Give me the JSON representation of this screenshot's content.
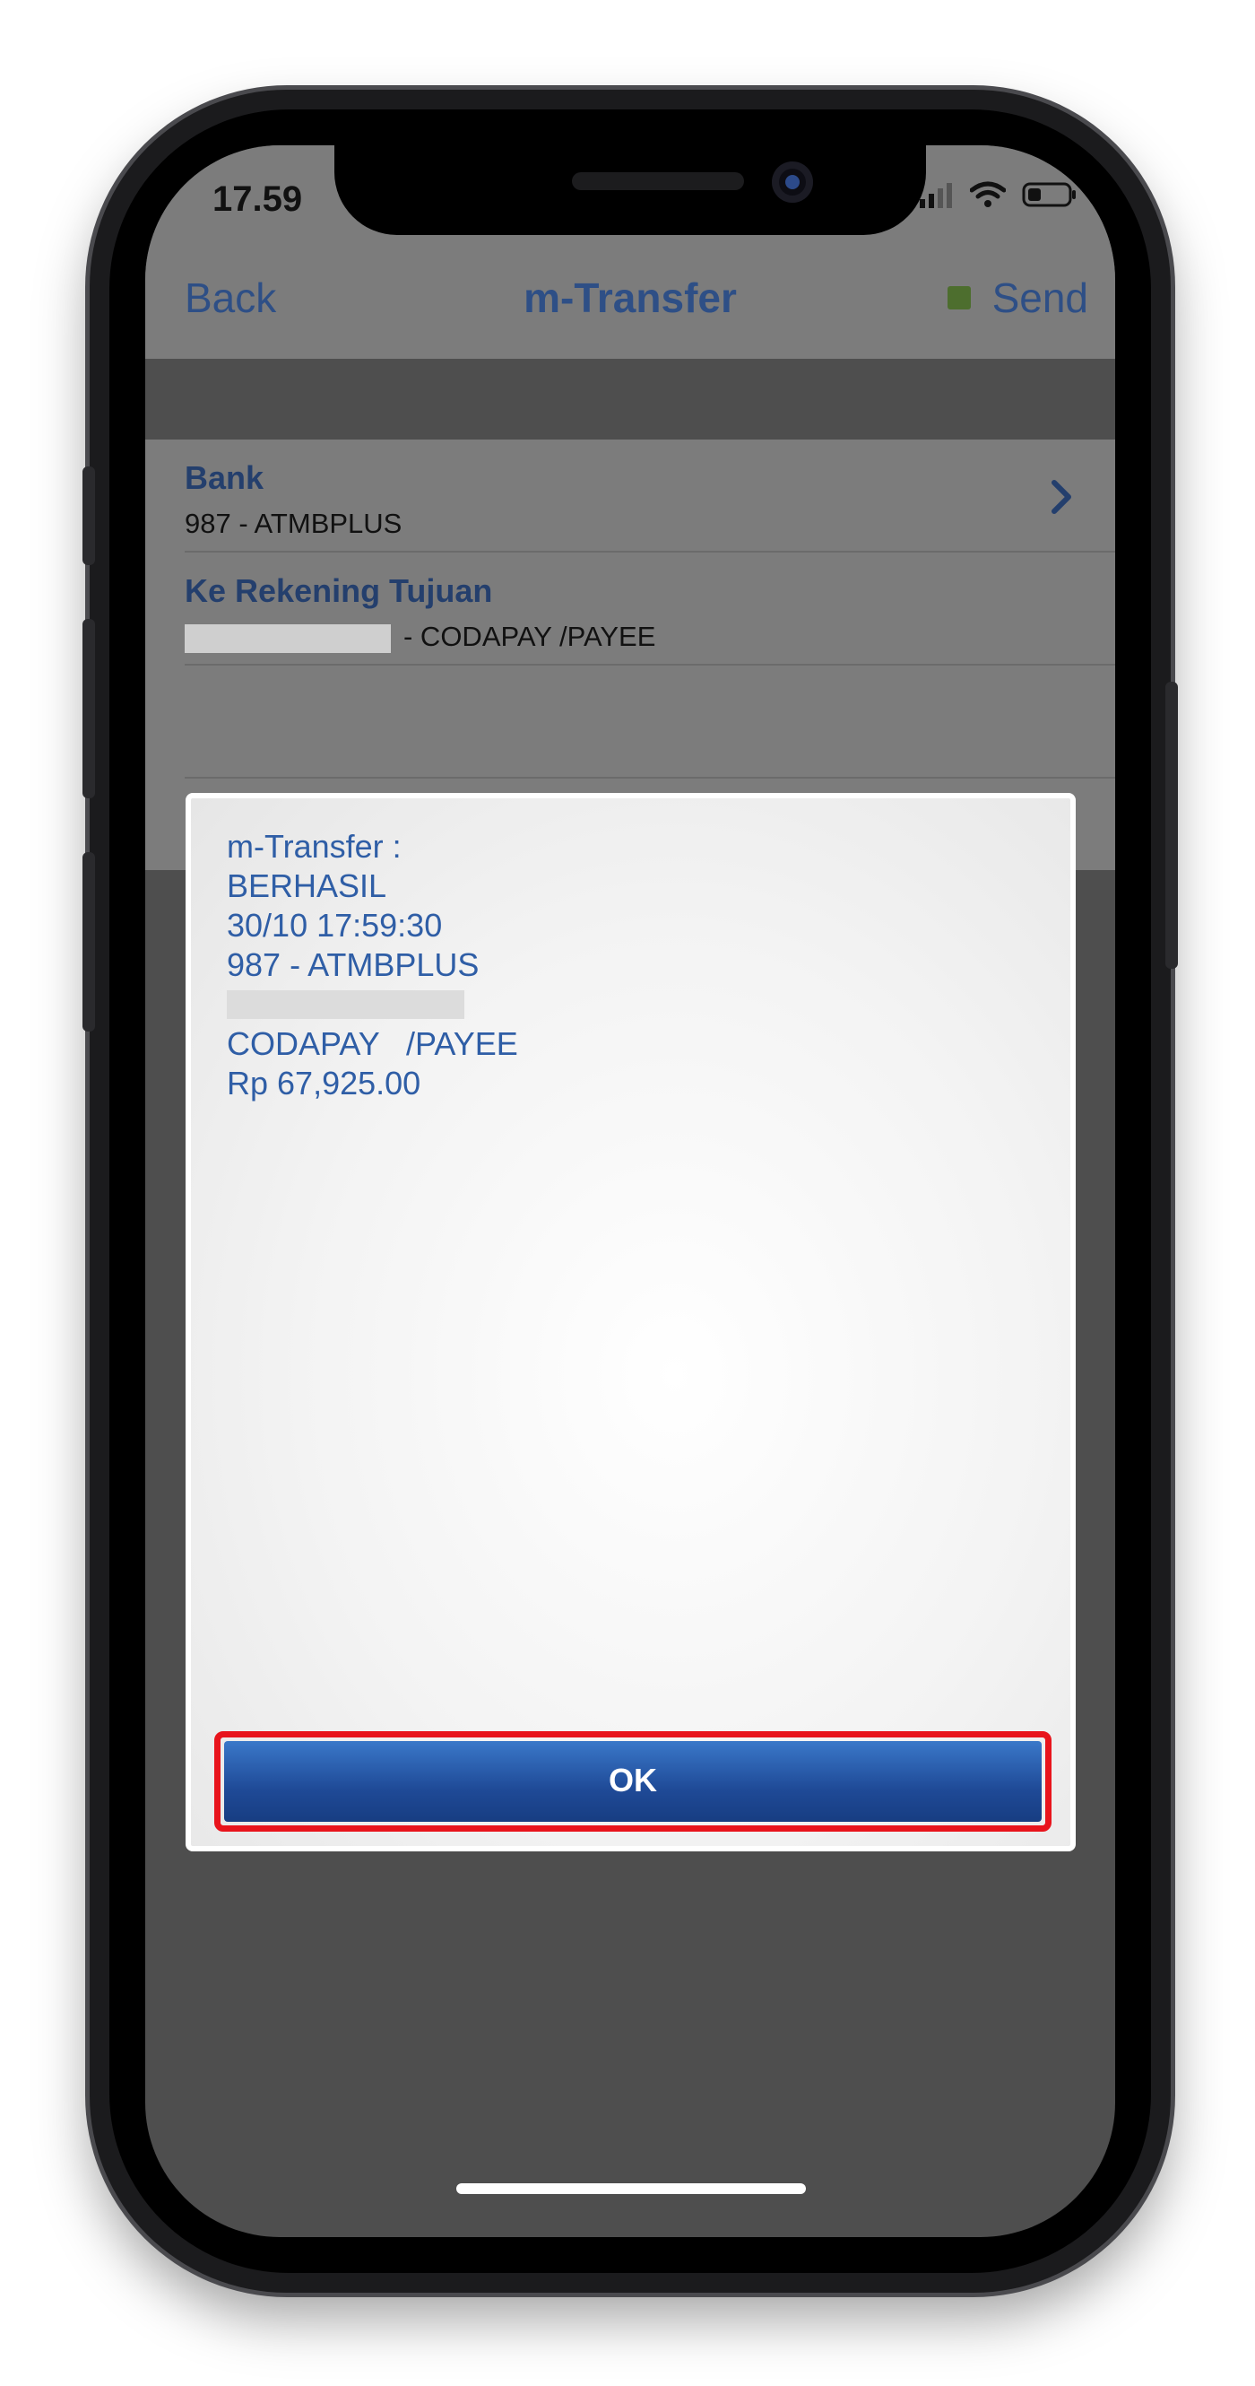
{
  "status_bar": {
    "time": "17.59"
  },
  "nav": {
    "back_label": "Back",
    "title": "m-Transfer",
    "send_label": "Send"
  },
  "rows": [
    {
      "label": "Bank",
      "value": "987 - ATMBPLUS"
    },
    {
      "label": "Ke Rekening Tujuan",
      "value": "- CODAPAY   /PAYEE"
    }
  ],
  "dialog": {
    "title": "m-Transfer :",
    "status": "BERHASIL",
    "datetime": "30/10 17:59:30",
    "bank": "987 - ATMBPLUS",
    "payee": "CODAPAY   /PAYEE",
    "amount": "Rp 67,925.00",
    "ok_label": "OK"
  },
  "colors": {
    "accent": "#2e4f86",
    "dialog_text": "#2f5ea6",
    "ok_button": "#1f4a97",
    "highlight_border": "#e8141c"
  },
  "icons": [
    "chevron-right-icon",
    "signal-icon",
    "wifi-icon",
    "battery-icon"
  ]
}
